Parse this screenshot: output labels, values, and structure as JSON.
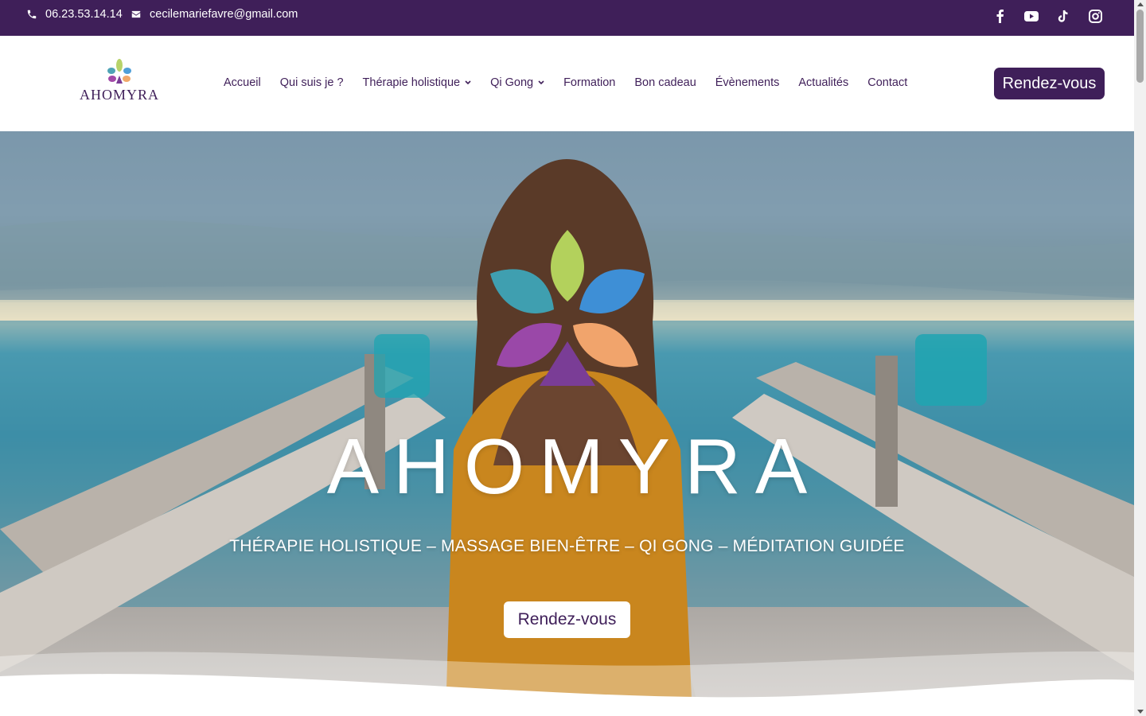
{
  "topbar": {
    "phone": "06.23.53.14.14",
    "email": "cecilemariefavre@gmail.com",
    "social": [
      "facebook-icon",
      "youtube-icon",
      "tiktok-icon",
      "instagram-icon"
    ]
  },
  "header": {
    "logo_text": "AHOMYRA",
    "nav": [
      {
        "label": "Accueil",
        "dropdown": false
      },
      {
        "label": "Qui suis je ?",
        "dropdown": false
      },
      {
        "label": "Thérapie holistique",
        "dropdown": true
      },
      {
        "label": "Qi Gong",
        "dropdown": true
      },
      {
        "label": "Formation",
        "dropdown": false
      },
      {
        "label": "Bon cadeau",
        "dropdown": false
      },
      {
        "label": "Évènements",
        "dropdown": false
      },
      {
        "label": "Actualités",
        "dropdown": false
      },
      {
        "label": "Contact",
        "dropdown": false
      }
    ],
    "cta_label": "Rendez-vous"
  },
  "hero": {
    "title": "AHOMYRA",
    "subtitle": "THÉRAPIE HOLISTIQUE – MASSAGE BIEN-ÊTRE – QI GONG – MÉDITATION GUIDÉE",
    "button_label": "Rendez-vous"
  },
  "colors": {
    "brand": "#3f1f59",
    "white": "#ffffff"
  }
}
